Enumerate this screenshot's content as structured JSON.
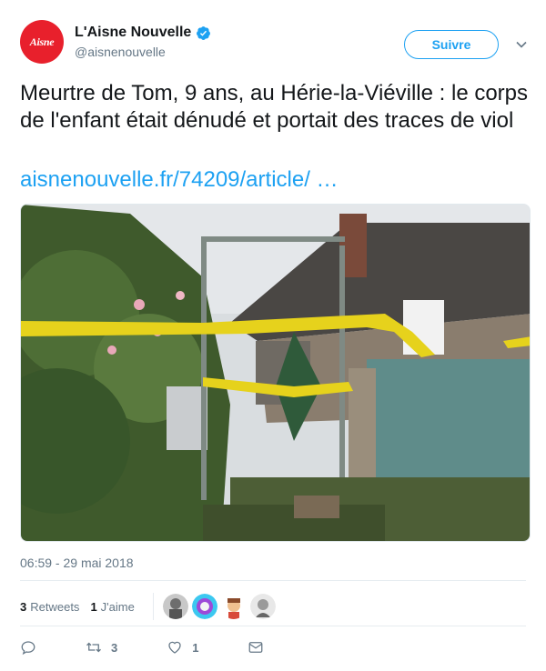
{
  "account": {
    "display_name": "L'Aisne Nouvelle",
    "handle": "@aisnenouvelle",
    "avatar_text": "Aisne",
    "brand_color": "#e8202c",
    "verified": true
  },
  "follow_button": {
    "label": "Suivre"
  },
  "tweet": {
    "text": "Meurtre de Tom, 9 ans, au Hérie-la-Viéville : le corps de l'enfant était dénudé et portait des traces de viol",
    "link": "aisnenouvelle.fr/74209/article/  …",
    "timestamp": "06:59 - 29 mai 2018"
  },
  "stats": {
    "retweets_count": "3",
    "retweets_label": "Retweets",
    "likes_count": "1",
    "likes_label": "J'aime"
  },
  "actions": {
    "reply_icon": "reply-icon",
    "retweet_count": "3",
    "like_count": "1",
    "dm_icon": "direct-message-icon"
  },
  "colors": {
    "accent": "#1da1f2",
    "muted": "#657786",
    "text": "#14171a"
  }
}
